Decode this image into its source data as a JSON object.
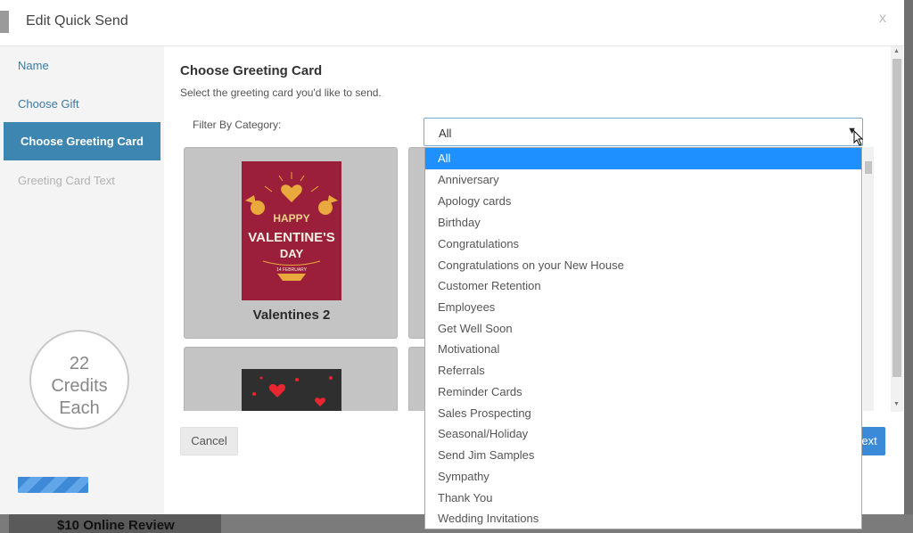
{
  "background": {
    "tab_label": "$10 Online Review"
  },
  "modal": {
    "title": "Edit Quick Send",
    "close_label": "x"
  },
  "sidebar": {
    "items": [
      {
        "label": "Name"
      },
      {
        "label": "Choose Gift"
      },
      {
        "label": "Choose Greeting Card"
      },
      {
        "label": "Greeting Card Text"
      }
    ],
    "credits": {
      "count": "22",
      "line2": "Credits",
      "line3": "Each"
    }
  },
  "content": {
    "title": "Choose Greeting Card",
    "subtitle": "Select the greeting card you'd like to send.",
    "filter_label": "Filter By Category:",
    "filter_value": "All",
    "cards": [
      {
        "label": "Valentines 2"
      }
    ],
    "card_art": {
      "line1": "HAPPY",
      "line2": "VALENTINE'S",
      "line3": "DAY",
      "line4": "14 FEBRUARY"
    },
    "cancel_label": "Cancel",
    "next_label": "Next"
  },
  "dropdown": {
    "options": [
      "All",
      "Anniversary",
      "Apology cards",
      "Birthday",
      "Congratulations",
      "Congratulations on your New House",
      "Customer Retention",
      "Employees",
      "Get Well Soon",
      "Motivational",
      "Referrals",
      "Reminder Cards",
      "Sales Prospecting",
      "Seasonal/Holiday",
      "Send Jim Samples",
      "Sympathy",
      "Thank You",
      "Wedding Invitations"
    ],
    "selected_index": 0
  },
  "colors": {
    "accent": "#3d86b1",
    "highlight": "#1e90ff",
    "button_primary": "#3b8ad8"
  }
}
